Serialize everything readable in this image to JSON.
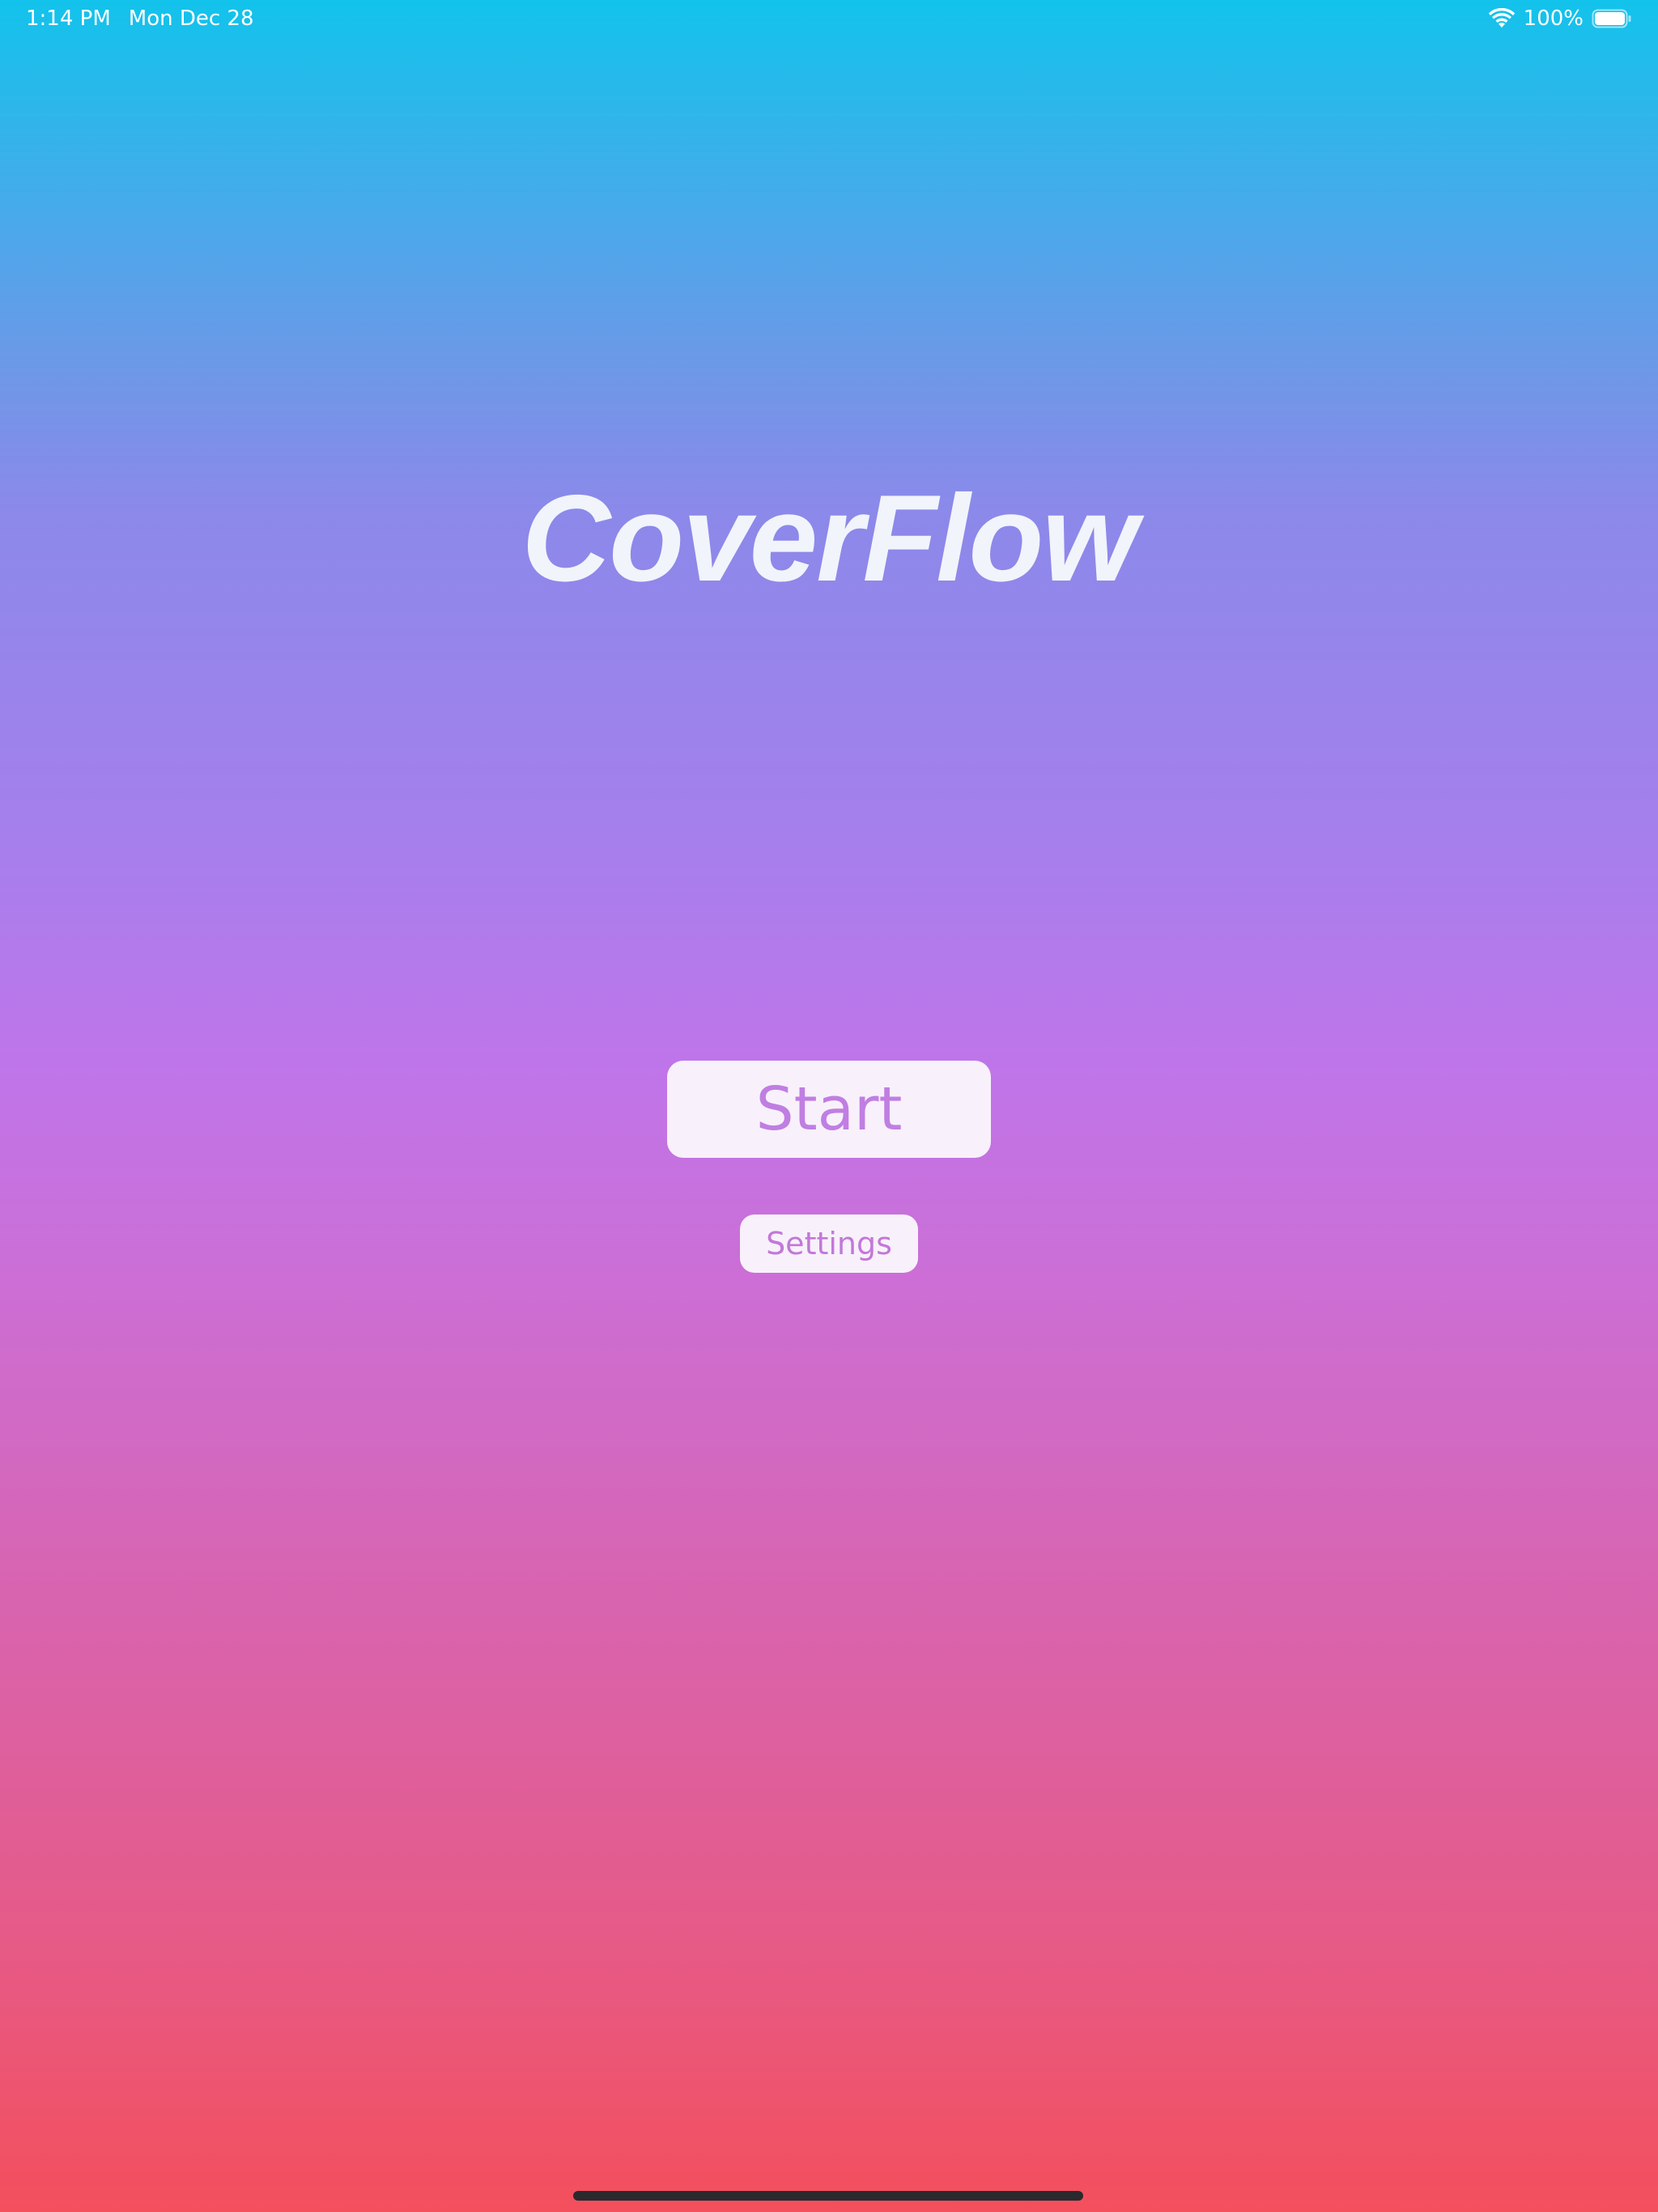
{
  "status_bar": {
    "time": "1:14 PM",
    "date": "Mon Dec 28",
    "battery_percent": "100%",
    "battery_level": 1.0,
    "icons": [
      "wifi-icon",
      "battery-icon"
    ]
  },
  "app": {
    "title": "CoverFlow"
  },
  "buttons": {
    "start_label": "Start",
    "settings_label": "Settings"
  },
  "colors": {
    "gradient_top": "#12c3eb",
    "gradient_middle": "#bf75ea",
    "gradient_bottom": "#f44f5c",
    "button_background": "#f8f1fb",
    "button_text": "#c07ee2",
    "title_text": "#f1f4fb"
  }
}
